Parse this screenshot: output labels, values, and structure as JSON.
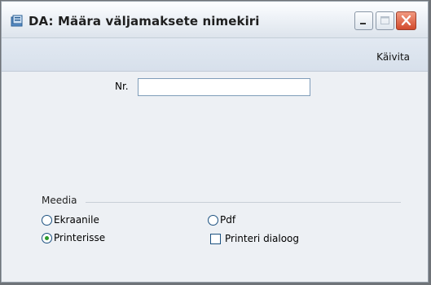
{
  "window": {
    "title": "DA: Määra väljamaksete nimekiri"
  },
  "toolbar": {
    "run_label": "Käivita"
  },
  "form": {
    "nr_label": "Nr.",
    "nr_value": ""
  },
  "media": {
    "group_label": "Meedia",
    "options": [
      {
        "label": "Ekraanile",
        "selected": false
      },
      {
        "label": "Printerisse",
        "selected": true
      },
      {
        "label": "Pdf",
        "selected": false
      }
    ],
    "printer_dialog": {
      "label": "Printeri dialoog",
      "checked": false
    }
  },
  "colors": {
    "window_bg": "#edf0f4",
    "toolbar_bg": "#dbe3ee",
    "close_button": "#d24a2c"
  }
}
